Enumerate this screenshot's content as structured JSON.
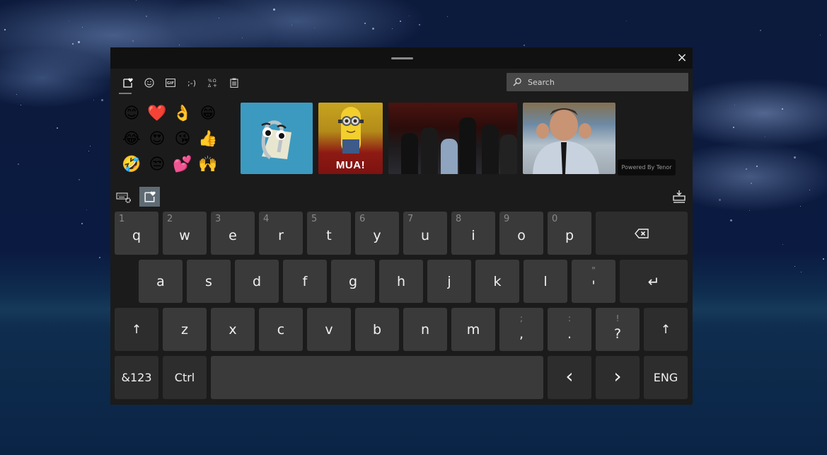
{
  "window": {
    "close_icon": "×"
  },
  "tabs": [
    {
      "name": "favorites",
      "icon": "heart-square-icon",
      "active": true
    },
    {
      "name": "emoji",
      "icon": "smiley-icon",
      "active": false
    },
    {
      "name": "gif",
      "icon": "gif-icon",
      "label": "GIF",
      "active": false
    },
    {
      "name": "kaomoji",
      "icon": "kaomoji-icon",
      "label": ";-)",
      "active": false
    },
    {
      "name": "symbols",
      "icon": "symbols-icon",
      "active": false
    },
    {
      "name": "clipboard",
      "icon": "clipboard-icon",
      "active": false
    }
  ],
  "search": {
    "placeholder": "Search"
  },
  "emojis": [
    "😊",
    "❤️",
    "👌",
    "😁",
    "😂",
    "😍",
    "😘",
    "👍",
    "🤣",
    "😒",
    "💕",
    "🙌"
  ],
  "gifs": [
    {
      "name": "clippy",
      "caption": ""
    },
    {
      "name": "minion",
      "caption": "MUA!"
    },
    {
      "name": "oscars-applause",
      "caption": ""
    },
    {
      "name": "jonah-excited",
      "caption": ""
    }
  ],
  "tenor_label": "Powered By Tenor",
  "keyboard": {
    "row1": [
      {
        "hint": "1",
        "key": "q"
      },
      {
        "hint": "2",
        "key": "w"
      },
      {
        "hint": "3",
        "key": "e"
      },
      {
        "hint": "4",
        "key": "r"
      },
      {
        "hint": "5",
        "key": "t"
      },
      {
        "hint": "6",
        "key": "y"
      },
      {
        "hint": "7",
        "key": "u"
      },
      {
        "hint": "8",
        "key": "i"
      },
      {
        "hint": "9",
        "key": "o"
      },
      {
        "hint": "0",
        "key": "p"
      }
    ],
    "backspace_icon": "⌫",
    "row2": [
      "a",
      "s",
      "d",
      "f",
      "g",
      "h",
      "j",
      "k",
      "l"
    ],
    "apostrophe": {
      "secondary": "\"",
      "key": "'"
    },
    "enter_icon": "↵",
    "shift_icon": "↑",
    "row3": [
      "z",
      "x",
      "c",
      "v",
      "b",
      "n",
      "m"
    ],
    "punct": [
      {
        "secondary": ";",
        "key": ","
      },
      {
        "secondary": ":",
        "key": "."
      },
      {
        "secondary": "!",
        "key": "?"
      }
    ],
    "symbols_label": "&123",
    "ctrl_label": "Ctrl",
    "left_icon": "‹",
    "right_icon": "›",
    "lang_label": "ENG"
  },
  "colors": {
    "panel": "#1b1b1b",
    "key": "#3a3a3a",
    "fn_key": "#2d2d2d",
    "accent_toggle": "#5f6b74"
  }
}
